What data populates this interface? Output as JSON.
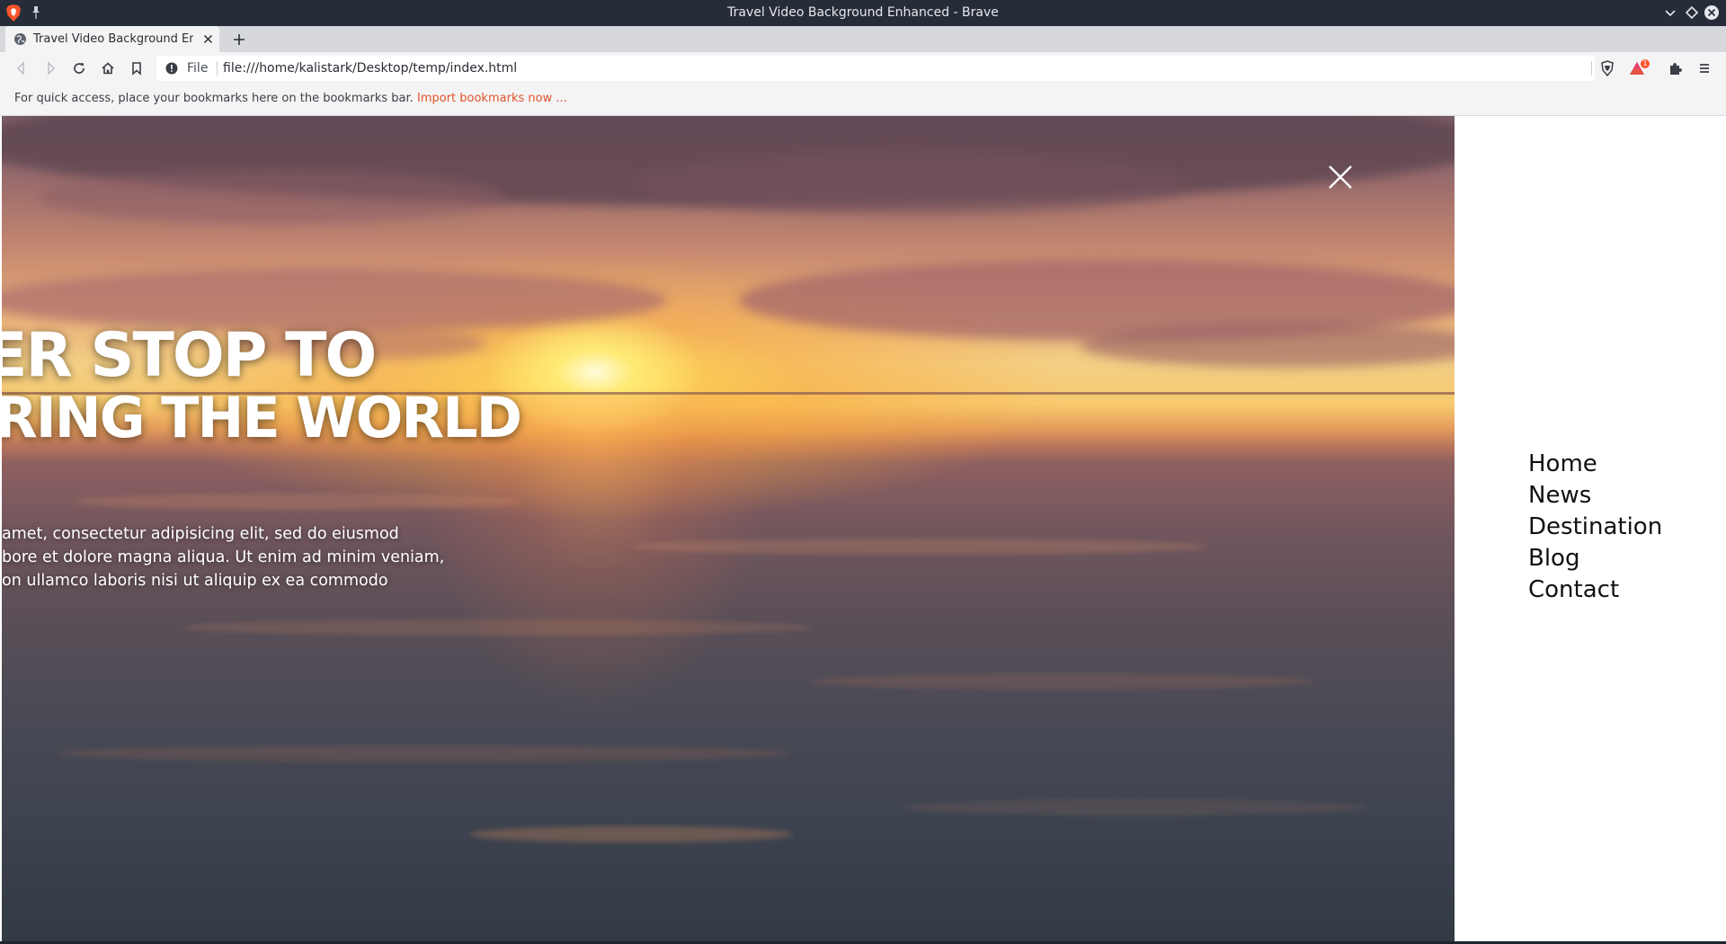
{
  "window": {
    "title": "Travel Video Background Enhanced - Brave"
  },
  "tabs": [
    {
      "label": "Travel Video Background En",
      "active": true
    }
  ],
  "toolbar": {
    "scheme_label": "File",
    "url": "file:///home/kalistark/Desktop/temp/index.html",
    "notification_count": "1"
  },
  "bookmarks_bar": {
    "message": "For quick access, place your bookmarks here on the bookmarks bar.",
    "import_link": "Import bookmarks now ..."
  },
  "hero": {
    "headline_line1": "ER STOP TO",
    "headline_line2": "RING THE WORLD",
    "intro_lines": [
      "amet, consectetur adipisicing elit, sed do eiusmod",
      "bore et dolore magna aliqua. Ut enim ad minim veniam,",
      "on ullamco laboris nisi ut aliquip ex ea commodo"
    ]
  },
  "nav": {
    "items": [
      "Home",
      "News",
      "Destination",
      "Blog",
      "Contact"
    ]
  },
  "colors": {
    "titlebar": "#262d39",
    "accent_link": "#e0552b",
    "brave_orange": "#fb542b"
  },
  "icons": [
    "brave-logo-icon",
    "pin-icon",
    "chevron-down-icon",
    "diamond-icon",
    "close-icon",
    "globe-icon",
    "plus-icon",
    "back-icon",
    "forward-icon",
    "reload-icon",
    "home-icon",
    "bookmark-icon",
    "info-icon",
    "brave-shield-icon",
    "brave-rewards-icon",
    "extensions-icon",
    "menu-icon"
  ]
}
